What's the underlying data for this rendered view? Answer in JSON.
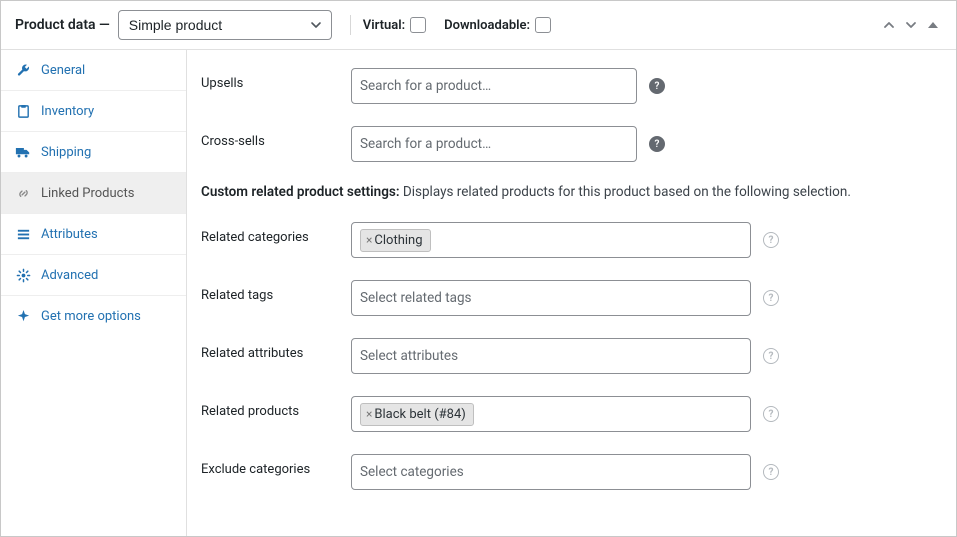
{
  "header": {
    "title_prefix": "Product data",
    "title_dash": " — ",
    "product_type": "Simple product",
    "virtual_label": "Virtual:",
    "downloadable_label": "Downloadable:"
  },
  "tabs": {
    "general": "General",
    "inventory": "Inventory",
    "shipping": "Shipping",
    "linked": "Linked Products",
    "attributes": "Attributes",
    "advanced": "Advanced",
    "more": "Get more options"
  },
  "content": {
    "upsells_label": "Upsells",
    "crosssells_label": "Cross-sells",
    "search_placeholder": "Search for a product…",
    "section_bold": "Custom related product settings:",
    "section_rest": " Displays related products for this product based on the following selection.",
    "rel_categories_label": "Related categories",
    "rel_categories_chip": "Clothing",
    "rel_tags_label": "Related tags",
    "rel_tags_placeholder": "Select related tags",
    "rel_attributes_label": "Related attributes",
    "rel_attributes_placeholder": "Select attributes",
    "rel_products_label": "Related products",
    "rel_products_chip": "Black belt (#84)",
    "exclude_categories_label": "Exclude categories",
    "exclude_categories_placeholder": "Select categories"
  }
}
